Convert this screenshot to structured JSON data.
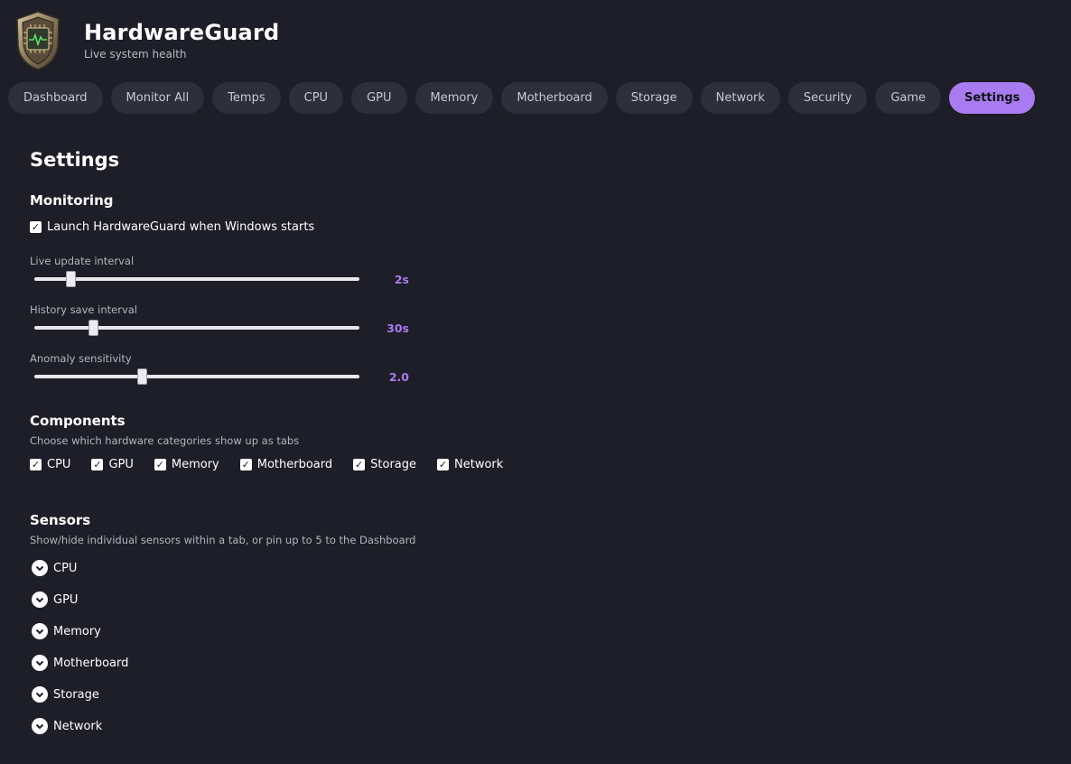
{
  "app": {
    "title": "HardwareGuard",
    "subtitle": "Live system health",
    "accent_color": "#a87cf0",
    "logo_icon": "shield-chip-icon"
  },
  "tabs": [
    {
      "label": "Dashboard",
      "active": false
    },
    {
      "label": "Monitor All",
      "active": false
    },
    {
      "label": "Temps",
      "active": false
    },
    {
      "label": "CPU",
      "active": false
    },
    {
      "label": "GPU",
      "active": false
    },
    {
      "label": "Memory",
      "active": false
    },
    {
      "label": "Motherboard",
      "active": false
    },
    {
      "label": "Storage",
      "active": false
    },
    {
      "label": "Network",
      "active": false
    },
    {
      "label": "Security",
      "active": false
    },
    {
      "label": "Game",
      "active": false
    },
    {
      "label": "Settings",
      "active": true
    }
  ],
  "settings": {
    "title": "Settings",
    "monitoring": {
      "title": "Monitoring",
      "launch_on_start": {
        "label": "Launch HardwareGuard when Windows starts",
        "checked": true
      },
      "sliders": [
        {
          "label": "Live update interval",
          "value": "2s",
          "fraction": 0.11
        },
        {
          "label": "History save interval",
          "value": "30s",
          "fraction": 0.18
        },
        {
          "label": "Anomaly sensitivity",
          "value": "2.0",
          "fraction": 0.33
        }
      ]
    },
    "components": {
      "title": "Components",
      "description": "Choose which hardware categories show up as tabs",
      "items": [
        {
          "label": "CPU",
          "checked": true
        },
        {
          "label": "GPU",
          "checked": true
        },
        {
          "label": "Memory",
          "checked": true
        },
        {
          "label": "Motherboard",
          "checked": true
        },
        {
          "label": "Storage",
          "checked": true
        },
        {
          "label": "Network",
          "checked": true
        }
      ]
    },
    "sensors": {
      "title": "Sensors",
      "description": "Show/hide individual sensors within a tab, or pin up to 5 to the Dashboard",
      "groups": [
        {
          "label": "CPU"
        },
        {
          "label": "GPU"
        },
        {
          "label": "Memory"
        },
        {
          "label": "Motherboard"
        },
        {
          "label": "Storage"
        },
        {
          "label": "Network"
        }
      ]
    }
  }
}
